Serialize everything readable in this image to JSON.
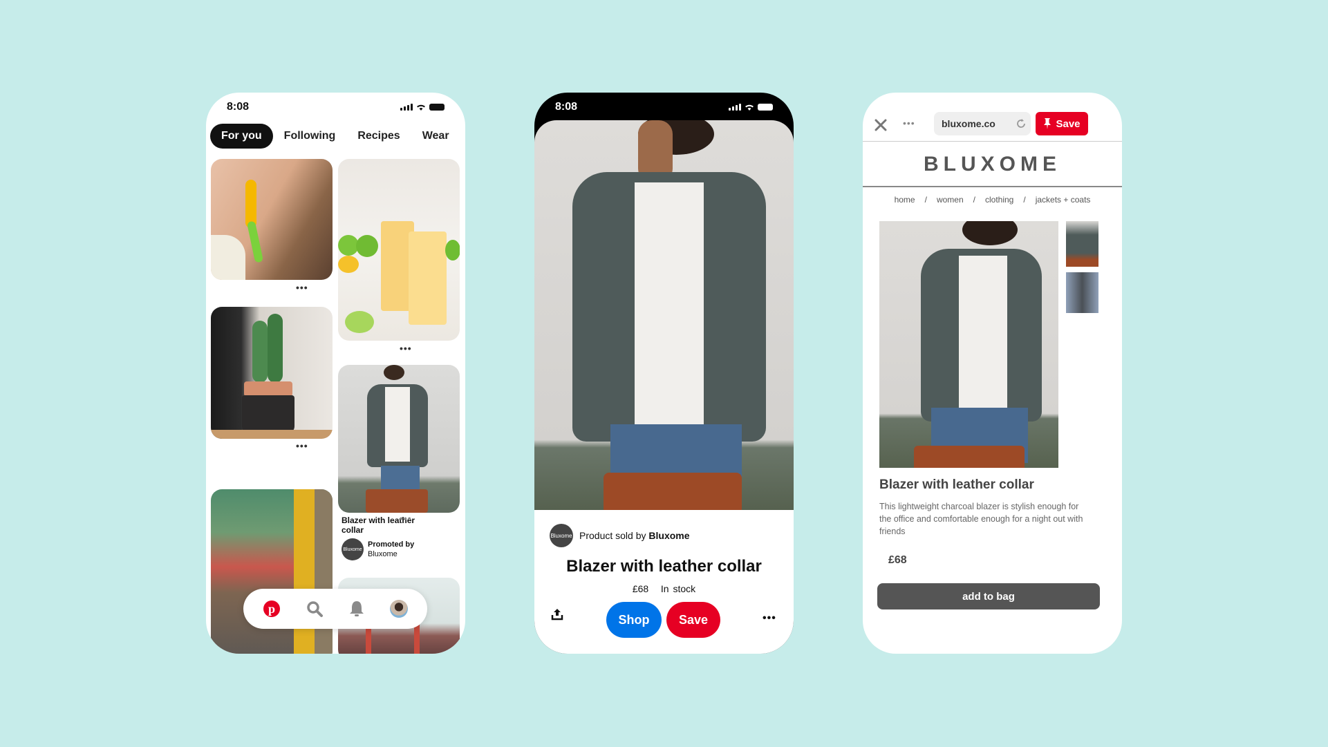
{
  "colors": {
    "background": "#c6ecea",
    "pinterest_red": "#e60023",
    "shop_blue": "#0074e8",
    "dark_gray": "#555555"
  },
  "phone1": {
    "status_time": "8:08",
    "tabs": [
      {
        "label": "For you",
        "active": true
      },
      {
        "label": "Following"
      },
      {
        "label": "Recipes"
      },
      {
        "label": "Wear"
      }
    ],
    "pins": [
      {
        "image": "earrings",
        "more": "•••"
      },
      {
        "image": "drinks",
        "more": "•••"
      },
      {
        "image": "cactus",
        "more": "•••"
      },
      {
        "image": "blazer",
        "title": "Blazer with leather collar",
        "promoted_label": "Promoted by",
        "promoter": "Bluxome",
        "avatar_text": "Bluxome",
        "more": "•••"
      },
      {
        "image": "street"
      },
      {
        "image": "bridge"
      }
    ],
    "nav": [
      "pinterest-logo-icon",
      "search-icon",
      "bell-icon",
      "profile-avatar"
    ]
  },
  "phone2": {
    "status_time": "8:08",
    "seller_avatar": "Bluxome",
    "sold_by_prefix": "Product sold by ",
    "seller": "Bluxome",
    "title": "Blazer with leather collar",
    "price": "£68",
    "stock": "In stock",
    "shop_label": "Shop",
    "save_label": "Save",
    "more": "•••"
  },
  "phone3": {
    "url": "bluxome.co",
    "save_label": "Save",
    "brand": "BLUXOME",
    "breadcrumbs": [
      "home",
      "women",
      "clothing",
      "jackets + coats"
    ],
    "breadcrumb_sep": "/",
    "product_title": "Blazer with leather collar",
    "description": "This lightweight charcoal blazer is stylish enough for the office and comfortable enough for a night out with friends",
    "price": "£68",
    "add_to_bag": "add to bag"
  }
}
